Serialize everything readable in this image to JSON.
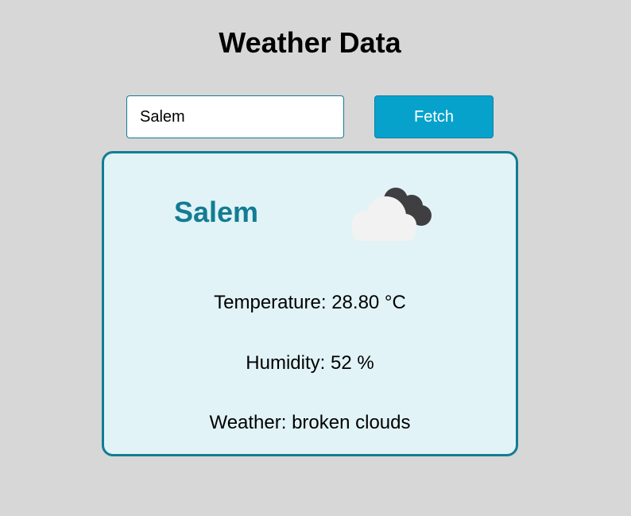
{
  "header": {
    "title": "Weather Data"
  },
  "search": {
    "value": "Salem",
    "button_label": "Fetch"
  },
  "weather": {
    "city": "Salem",
    "icon": "broken-clouds-icon",
    "temperature_label": "Temperature:",
    "temperature_value": "28.80 °C",
    "humidity_label": "Humidity:",
    "humidity_value": "52 %",
    "condition_label": "Weather:",
    "condition_value": "broken clouds"
  },
  "colors": {
    "background": "#d7d7d7",
    "accent": "#137c93",
    "button": "#06a2cc",
    "card_background": "#e1f3f7"
  }
}
